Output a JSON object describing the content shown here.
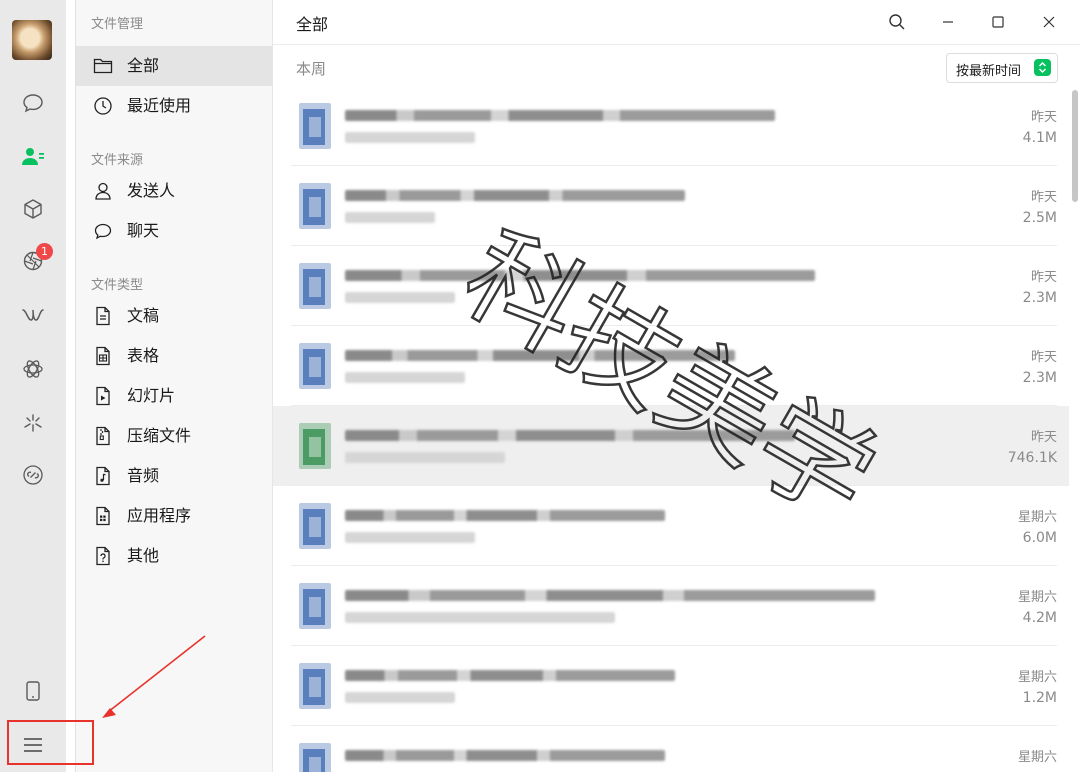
{
  "sidebar": {
    "header": "文件管理",
    "nav": [
      {
        "label": "全部",
        "icon": "folder-icon",
        "active": true
      },
      {
        "label": "最近使用",
        "icon": "clock-icon",
        "active": false
      }
    ],
    "source_title": "文件来源",
    "sources": [
      {
        "label": "发送人",
        "icon": "person-icon"
      },
      {
        "label": "聊天",
        "icon": "chat-bubble-icon"
      }
    ],
    "type_title": "文件类型",
    "types": [
      {
        "label": "文稿",
        "icon": "document-icon"
      },
      {
        "label": "表格",
        "icon": "spreadsheet-icon"
      },
      {
        "label": "幻灯片",
        "icon": "slides-icon"
      },
      {
        "label": "压缩文件",
        "icon": "zip-icon"
      },
      {
        "label": "音频",
        "icon": "audio-icon"
      },
      {
        "label": "应用程序",
        "icon": "app-icon"
      },
      {
        "label": "其他",
        "icon": "unknown-file-icon"
      }
    ]
  },
  "rail": {
    "moments_badge": "1",
    "icons": [
      "avatar",
      "chat-icon",
      "contacts-icon",
      "favorites-cube-icon",
      "moments-icon",
      "channels-icon",
      "mini-programs-icon",
      "search-sparkle-icon",
      "link-icon",
      "phone-icon",
      "menu-icon"
    ]
  },
  "header": {
    "title": "全部",
    "section": "本周",
    "sort_label": "按最新时间"
  },
  "files": [
    {
      "date": "昨天",
      "size": "4.1M",
      "kind": "word"
    },
    {
      "date": "昨天",
      "size": "2.5M",
      "kind": "word"
    },
    {
      "date": "昨天",
      "size": "2.3M",
      "kind": "word"
    },
    {
      "date": "昨天",
      "size": "2.3M",
      "kind": "word"
    },
    {
      "date": "昨天",
      "size": "746.1K",
      "kind": "excel"
    },
    {
      "date": "星期六",
      "size": "6.0M",
      "kind": "word"
    },
    {
      "date": "星期六",
      "size": "4.2M",
      "kind": "word"
    },
    {
      "date": "星期六",
      "size": "1.2M",
      "kind": "word"
    },
    {
      "date": "星期六",
      "size": "",
      "kind": "word"
    }
  ],
  "watermark": "科技美学",
  "colors": {
    "accent_green": "#07c160",
    "badge_red": "#f04848",
    "word_blue": "#3a66b0",
    "excel_green": "#2e8b4a",
    "annotation_red": "#e8322c"
  }
}
